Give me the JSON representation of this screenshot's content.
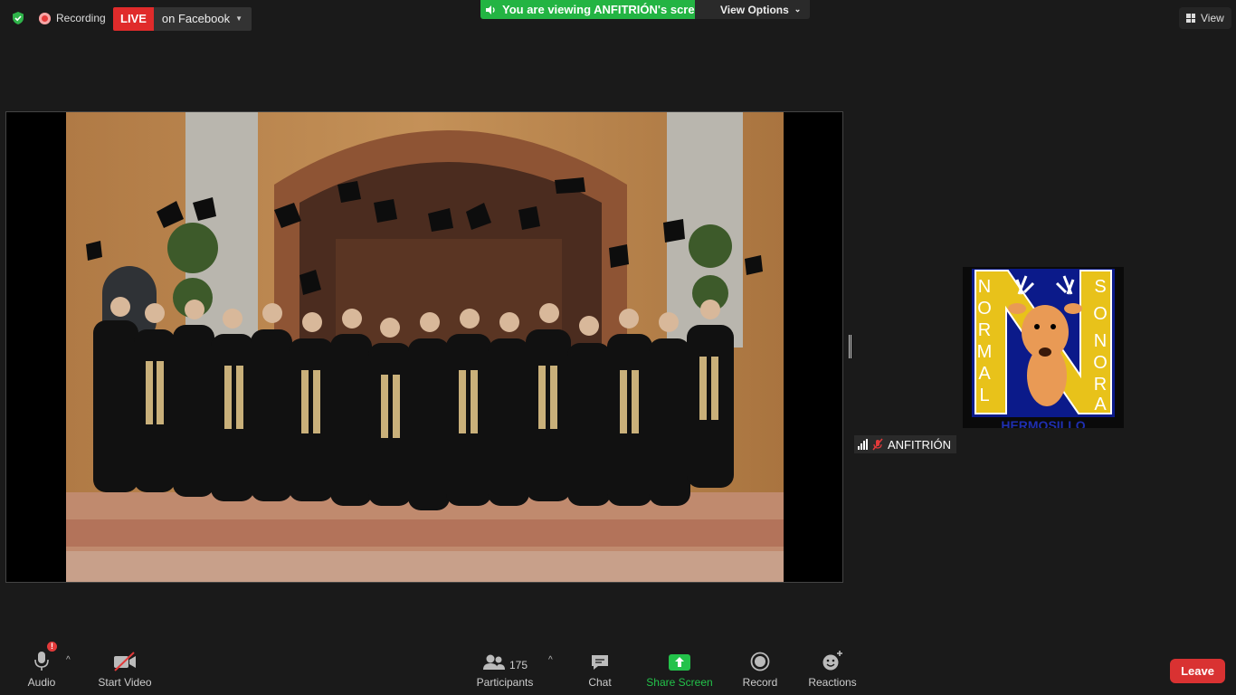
{
  "topbar": {
    "recording_label": "Recording",
    "live_label": "LIVE",
    "live_destination": "on Facebook",
    "viewing_banner": "You are viewing ANFITRIÓN's screen",
    "view_options_label": "View Options",
    "view_label": "View"
  },
  "participant": {
    "name": "ANFITRIÓN",
    "avatar_logo": {
      "letters_left": "NORMAL",
      "letters_right": "SONORA",
      "bottom_text": "HERMOSILLO"
    }
  },
  "toolbar": {
    "audio_label": "Audio",
    "audio_badge": "!",
    "video_label": "Start Video",
    "participants_label": "Participants",
    "participants_count": "175",
    "chat_label": "Chat",
    "share_label": "Share Screen",
    "record_label": "Record",
    "reactions_label": "Reactions",
    "leave_label": "Leave"
  },
  "colors": {
    "background": "#1a1a1a",
    "share_green": "#23b443",
    "live_red": "#e02b2b",
    "leave_red": "#d93232",
    "logo_blue": "#0b1a8a"
  }
}
